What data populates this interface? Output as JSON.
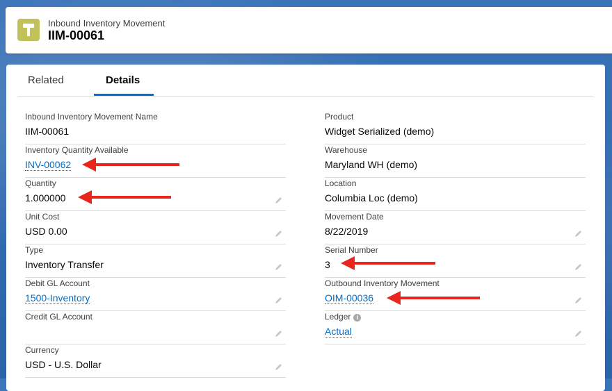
{
  "header": {
    "object_label": "Inbound Inventory Movement",
    "record_name": "IIM-00061",
    "icon": "hammer-icon"
  },
  "tabs": [
    {
      "label": "Related",
      "active": false
    },
    {
      "label": "Details",
      "active": true
    }
  ],
  "fields_left": [
    {
      "label": "Inbound Inventory Movement Name",
      "value": "IIM-00061",
      "link": false,
      "editable": false
    },
    {
      "label": "Inventory Quantity Available",
      "value": "INV-00062",
      "link": true,
      "editable": false
    },
    {
      "label": "Quantity",
      "value": "1.000000",
      "link": false,
      "editable": true
    },
    {
      "label": "Unit Cost",
      "value": "USD 0.00",
      "link": false,
      "editable": true
    },
    {
      "label": "Type",
      "value": "Inventory Transfer",
      "link": false,
      "editable": true
    },
    {
      "label": "Debit GL Account",
      "value": "1500-Inventory",
      "link": true,
      "editable": true
    },
    {
      "label": "Credit GL Account",
      "value": "",
      "link": false,
      "editable": true
    },
    {
      "label": "Currency",
      "value": "USD - U.S. Dollar",
      "link": false,
      "editable": true
    }
  ],
  "fields_right": [
    {
      "label": "Product",
      "value": "Widget Serialized (demo)",
      "link": false,
      "editable": false
    },
    {
      "label": "Warehouse",
      "value": "Maryland WH (demo)",
      "link": false,
      "editable": false
    },
    {
      "label": "Location",
      "value": "Columbia Loc (demo)",
      "link": false,
      "editable": false
    },
    {
      "label": "Movement Date",
      "value": "8/22/2019",
      "link": false,
      "editable": true
    },
    {
      "label": "Serial Number",
      "value": "3",
      "link": false,
      "editable": true
    },
    {
      "label": "Outbound Inventory Movement",
      "value": "OIM-00036",
      "link": true,
      "editable": true
    },
    {
      "label": "Ledger",
      "value": "Actual",
      "link": true,
      "editable": true,
      "info": true
    }
  ],
  "colors": {
    "link": "#006dcc",
    "annotation_arrow": "#e8261c",
    "tab_active": "#0070d2",
    "icon_bg": "#c2c25a"
  }
}
